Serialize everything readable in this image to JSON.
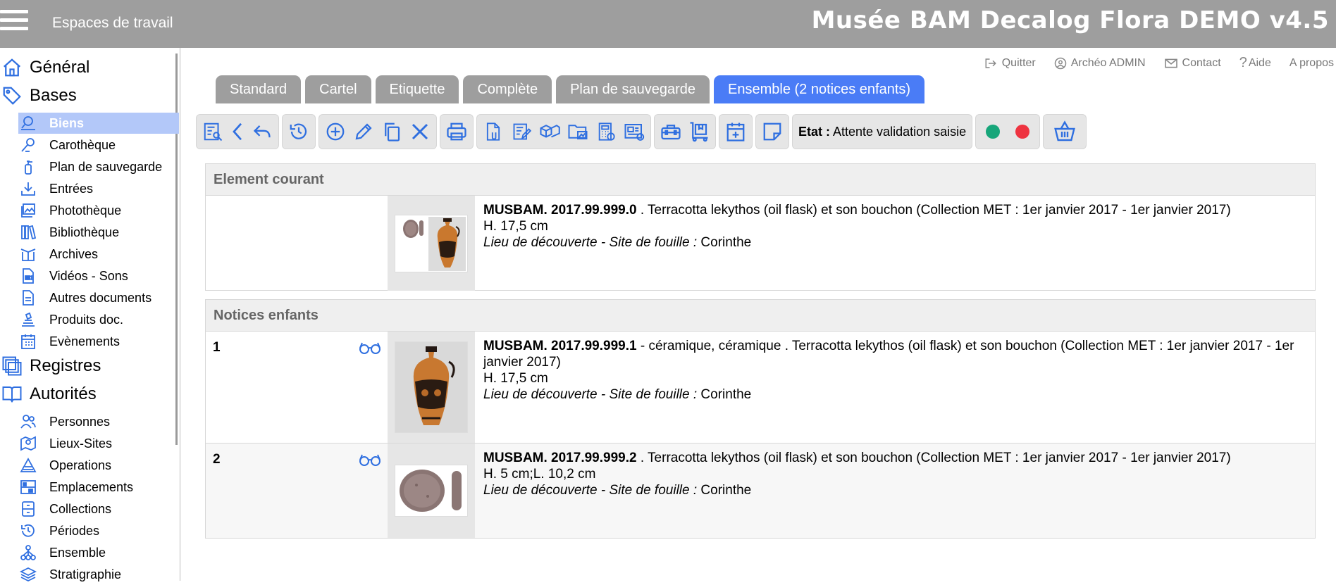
{
  "topbar": {
    "workspaces_label": "Espaces de travail",
    "app_title": "Musée BAM Decalog Flora DEMO v4.5"
  },
  "header_links": [
    {
      "label": "Quitter",
      "icon": "logout-icon"
    },
    {
      "label": "Archéo ADMIN",
      "icon": "user-circle-icon"
    },
    {
      "label": "Contact",
      "icon": "mail-icon"
    },
    {
      "label": "Aide",
      "icon": "question-icon"
    },
    {
      "label": "A propos",
      "icon": ""
    }
  ],
  "sidebar": {
    "groups": {
      "general": "Général",
      "bases": "Bases",
      "registres": "Registres",
      "autorites": "Autorités"
    },
    "bases_items": [
      "Biens",
      "Carothèque",
      "Plan de sauvegarde",
      "Entrées",
      "Photothèque",
      "Bibliothèque",
      "Archives",
      "Vidéos - Sons",
      "Autres documents",
      "Produits doc.",
      "Evènements"
    ],
    "autorites_items": [
      "Personnes",
      "Lieux-Sites",
      "Operations",
      "Emplacements",
      "Collections",
      "Périodes",
      "Ensemble",
      "Stratigraphie"
    ],
    "active_item": "Biens"
  },
  "tabs": [
    "Standard",
    "Cartel",
    "Etiquette",
    "Complète",
    "Plan de sauvegarde",
    "Ensemble (2 notices enfants)"
  ],
  "active_tab": "Ensemble (2 notices enfants)",
  "toolbar": {
    "etat_label": "Etat :",
    "etat_value": "Attente validation saisie",
    "status_colors": {
      "green": "#17a67a",
      "red": "#ee3340"
    },
    "accent": "#2f6fe0"
  },
  "current": {
    "header": "Element courant",
    "ref": "MUSBAM. 2017.99.999.0",
    "desc": " . Terracotta lekythos (oil flask) et son bouchon (Collection MET : 1er janvier 2017 - 1er janvier 2017)",
    "dims": "H. 17,5 cm",
    "place_label": "Lieu de découverte - Site de fouille :",
    "place_value": " Corinthe"
  },
  "children": {
    "header": "Notices enfants",
    "rows": [
      {
        "num": "1",
        "ref": "MUSBAM. 2017.99.999.1",
        "desc": " - céramique, céramique . Terracotta lekythos (oil flask) et son bouchon (Collection MET : 1er janvier 2017 - 1er janvier 2017)",
        "dims": "H. 17,5 cm",
        "place_label": "Lieu de découverte - Site de fouille :",
        "place_value": " Corinthe"
      },
      {
        "num": "2",
        "ref": "MUSBAM. 2017.99.999.2",
        "desc": " . Terracotta lekythos (oil flask) et son bouchon (Collection MET : 1er janvier 2017 - 1er janvier 2017)",
        "dims": "H. 5 cm;L. 10,2 cm",
        "place_label": "Lieu de découverte - Site de fouille :",
        "place_value": " Corinthe"
      }
    ]
  }
}
